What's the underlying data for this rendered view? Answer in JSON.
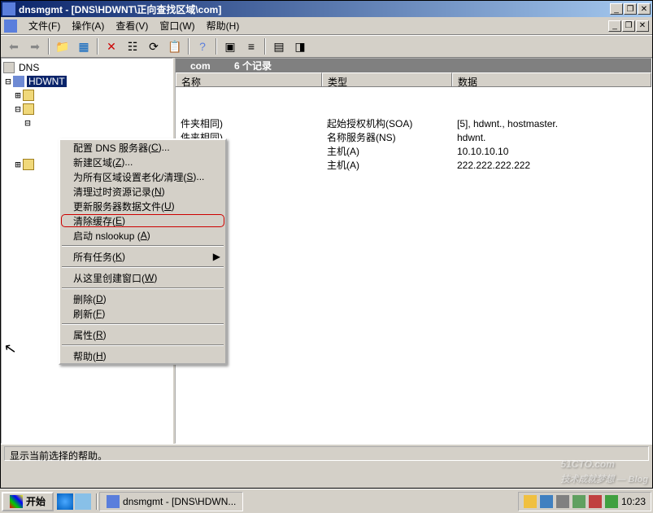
{
  "title": "dnsmgmt - [DNS\\HDWNT\\正向查找区域\\com]",
  "menus": {
    "file": "文件(F)",
    "action": "操作(A)",
    "view": "查看(V)",
    "window": "窗口(W)",
    "help": "帮助(H)"
  },
  "tree": {
    "root": "DNS",
    "server": "HDWNT"
  },
  "pathbar": {
    "zone": "com",
    "count": "6 个记录"
  },
  "cols": {
    "name": "名称",
    "type": "类型",
    "data": "数据",
    "w1": 180,
    "w2": 160,
    "w3": 230
  },
  "rows": [
    {
      "n": "件夹相同)",
      "t": "起始授权机构(SOA)",
      "d": "[5], hdwnt., hostmaster."
    },
    {
      "n": "件夹相同)",
      "t": "名称服务器(NS)",
      "d": "hdwnt."
    },
    {
      "n": "",
      "t": "主机(A)",
      "d": "10.10.10.10"
    },
    {
      "n": "",
      "t": "主机(A)",
      "d": "222.222.222.222"
    }
  ],
  "ctx": [
    {
      "l": "配置 DNS 服务器(C)..."
    },
    {
      "l": "新建区域(Z)..."
    },
    {
      "l": "为所有区域设置老化/清理(S)..."
    },
    {
      "l": "清理过时资源记录(N)"
    },
    {
      "l": "更新服务器数据文件(U)"
    },
    {
      "l": "清除缓存(E)",
      "hi": true
    },
    {
      "l": "启动 nslookup (A)"
    },
    {
      "sep": true
    },
    {
      "l": "所有任务(K)",
      "sub": true
    },
    {
      "sep": true
    },
    {
      "l": "从这里创建窗口(W)"
    },
    {
      "sep": true
    },
    {
      "l": "删除(D)"
    },
    {
      "l": "刷新(F)"
    },
    {
      "sep": true
    },
    {
      "l": "属性(R)"
    },
    {
      "sep": true
    },
    {
      "l": "帮助(H)"
    }
  ],
  "status": "显示当前选择的帮助。",
  "start": "开始",
  "task": "dnsmgmt - [DNS\\HDWN...",
  "clock": "10:23",
  "wm": {
    "a": "51CTO.com",
    "b": "技术成就梦想 — Blog"
  },
  "ql_icons": [
    "ie-icon",
    "desktop-icon"
  ],
  "sys_icons": [
    "shield-icon",
    "display-icon",
    "volume-icon",
    "network-icon",
    "ime-icon",
    "msn-icon"
  ]
}
